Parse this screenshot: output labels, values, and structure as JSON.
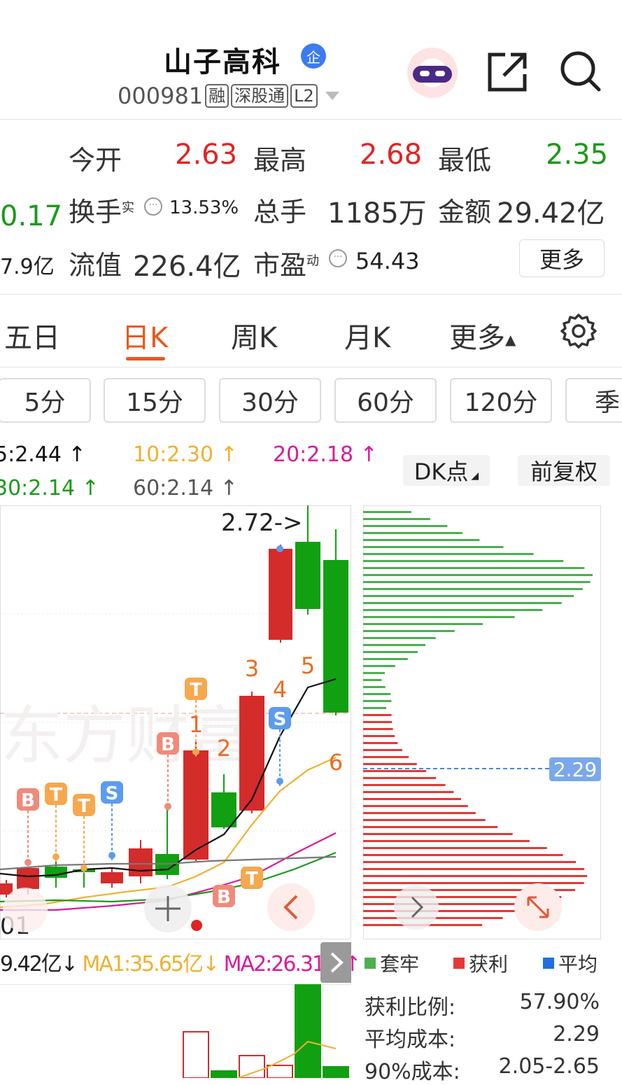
{
  "header": {
    "title": "山子高科",
    "title_badge": "企",
    "code": "000981",
    "tags": [
      "融",
      "深股通",
      "L2"
    ]
  },
  "quote": {
    "open_label": "今开",
    "open_value": "2.63",
    "high_label": "最高",
    "high_value": "2.68",
    "low_label": "最低",
    "low_value": "2.35",
    "left_partial_1": "0.17",
    "left_partial_2": "7.9亿",
    "turnover_label": "换手",
    "turnover_sup": "实",
    "turnover_value": "13.53%",
    "volume_label": "总手",
    "volume_value": "1185万",
    "amount_label": "金额",
    "amount_value": "29.42亿",
    "float_cap_label": "流值",
    "float_cap_value": "226.4亿",
    "pe_label": "市盈",
    "pe_sup": "动",
    "pe_value": "54.43",
    "more_button": "更多"
  },
  "tabs": {
    "five_day": "五日",
    "day_k": "日K",
    "week_k": "周K",
    "month_k": "月K",
    "more": "更多"
  },
  "periods": [
    "5分",
    "15分",
    "30分",
    "60分",
    "120分",
    "季"
  ],
  "ma": {
    "ma5": "5:2.44 ↑",
    "ma10": "10:2.30 ↑",
    "ma20": "20:2.18 ↑",
    "ma30": "30:2.14 ↑",
    "ma60": "60:2.14 ↑",
    "dk_button": "DK点",
    "adjust_button": "前复权"
  },
  "kchart": {
    "high_marker": "2.72->",
    "date_partial": "01",
    "signals": [
      "B",
      "T",
      "T",
      "S",
      "B",
      "T",
      "1",
      "2",
      "3",
      "4",
      "S",
      "5",
      "6",
      "B",
      "T"
    ],
    "colors": {
      "up": "#d42b2b",
      "down": "#11a011",
      "ma5": "#111111",
      "ma10": "#f0b030",
      "ma20": "#d81b9c",
      "ma30": "#1a9a1a",
      "ma60": "#777777"
    }
  },
  "chip": {
    "avg_label": "2.29",
    "legend": [
      "套牢",
      "获利",
      "平均"
    ],
    "legend_colors": [
      "#4caf50",
      "#e53935",
      "#1e6fe0"
    ],
    "profit_ratio_label": "获利比例:",
    "profit_ratio_value": "57.90%",
    "avg_cost_label": "平均成本:",
    "avg_cost_value": "2.29",
    "cost90_label": "90%成本:",
    "cost90_value": "2.05-2.65"
  },
  "volume": {
    "vol_label": "9.42亿↓",
    "ma1": "MA1:35.65亿↓",
    "ma2": "MA2:26.31亿↑"
  }
}
